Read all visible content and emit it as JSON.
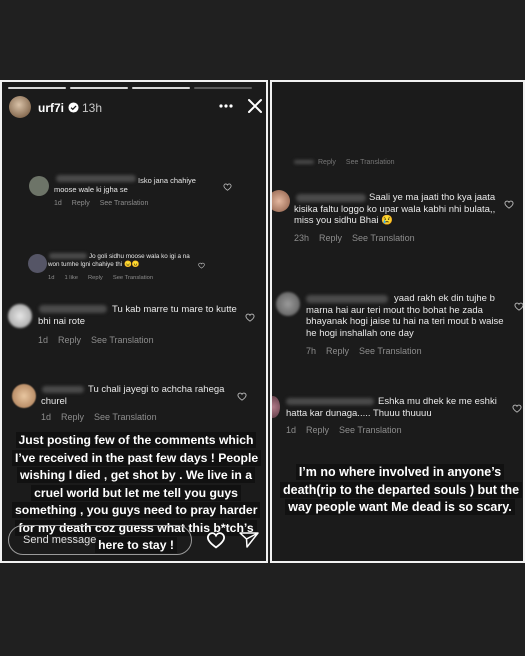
{
  "left": {
    "username": "urf7i",
    "time": "13h",
    "comments": [
      {
        "text": "Isko jana chahiye moose wale ki jgha se",
        "meta": [
          "1d",
          "Reply",
          "See Translation"
        ]
      },
      {
        "text": "Jo goli sidhu moose wala ko igi a na won tumhe lgni chahiye thi 😠😠",
        "meta": [
          "1d",
          "1 like",
          "Reply",
          "See Translation"
        ]
      },
      {
        "text": "Tu kab marre tu mare to kutte bhi nai rote",
        "meta": [
          "1d",
          "Reply",
          "See Translation"
        ]
      },
      {
        "text": "Tu chali jayegi to achcha rahega churel",
        "meta": [
          "1d",
          "Reply",
          "See Translation"
        ]
      }
    ],
    "caption": "Just posting few of the comments which I’ve received in the past few days ! People wishing I died , get shot by . We live in a cruel world but let me tell you guys something , you guys need to pray harder for my death coz guess what this b*tch’s here to stay !",
    "message_placeholder": "Send message"
  },
  "right": {
    "top_meta": [
      "Reply",
      "See Translation"
    ],
    "comments": [
      {
        "text": "Saali ye ma jaati tho kya jaata kisika faltu loggo ko upar wala kabhi nhi bulata,, miss you sidhu Bhai 😢",
        "meta": [
          "23h",
          "Reply",
          "See Translation"
        ]
      },
      {
        "text": "yaad rakh ek din tujhe b marna hai aur teri mout tho bohat he zada bhayanak hogi jaise tu hai na teri mout b waise he hogi inshallah one day",
        "meta": [
          "7h",
          "Reply",
          "See Translation"
        ]
      },
      {
        "text": "Eshka mu dhek ke me eshki hatta kar dunaga..... Thuuu thuuuu",
        "meta": [
          "1d",
          "Reply",
          "See Translation"
        ]
      }
    ],
    "caption": "I’m no where involved in anyone’s death(rip to the departed souls ) but the way people want Me dead is so scary."
  }
}
